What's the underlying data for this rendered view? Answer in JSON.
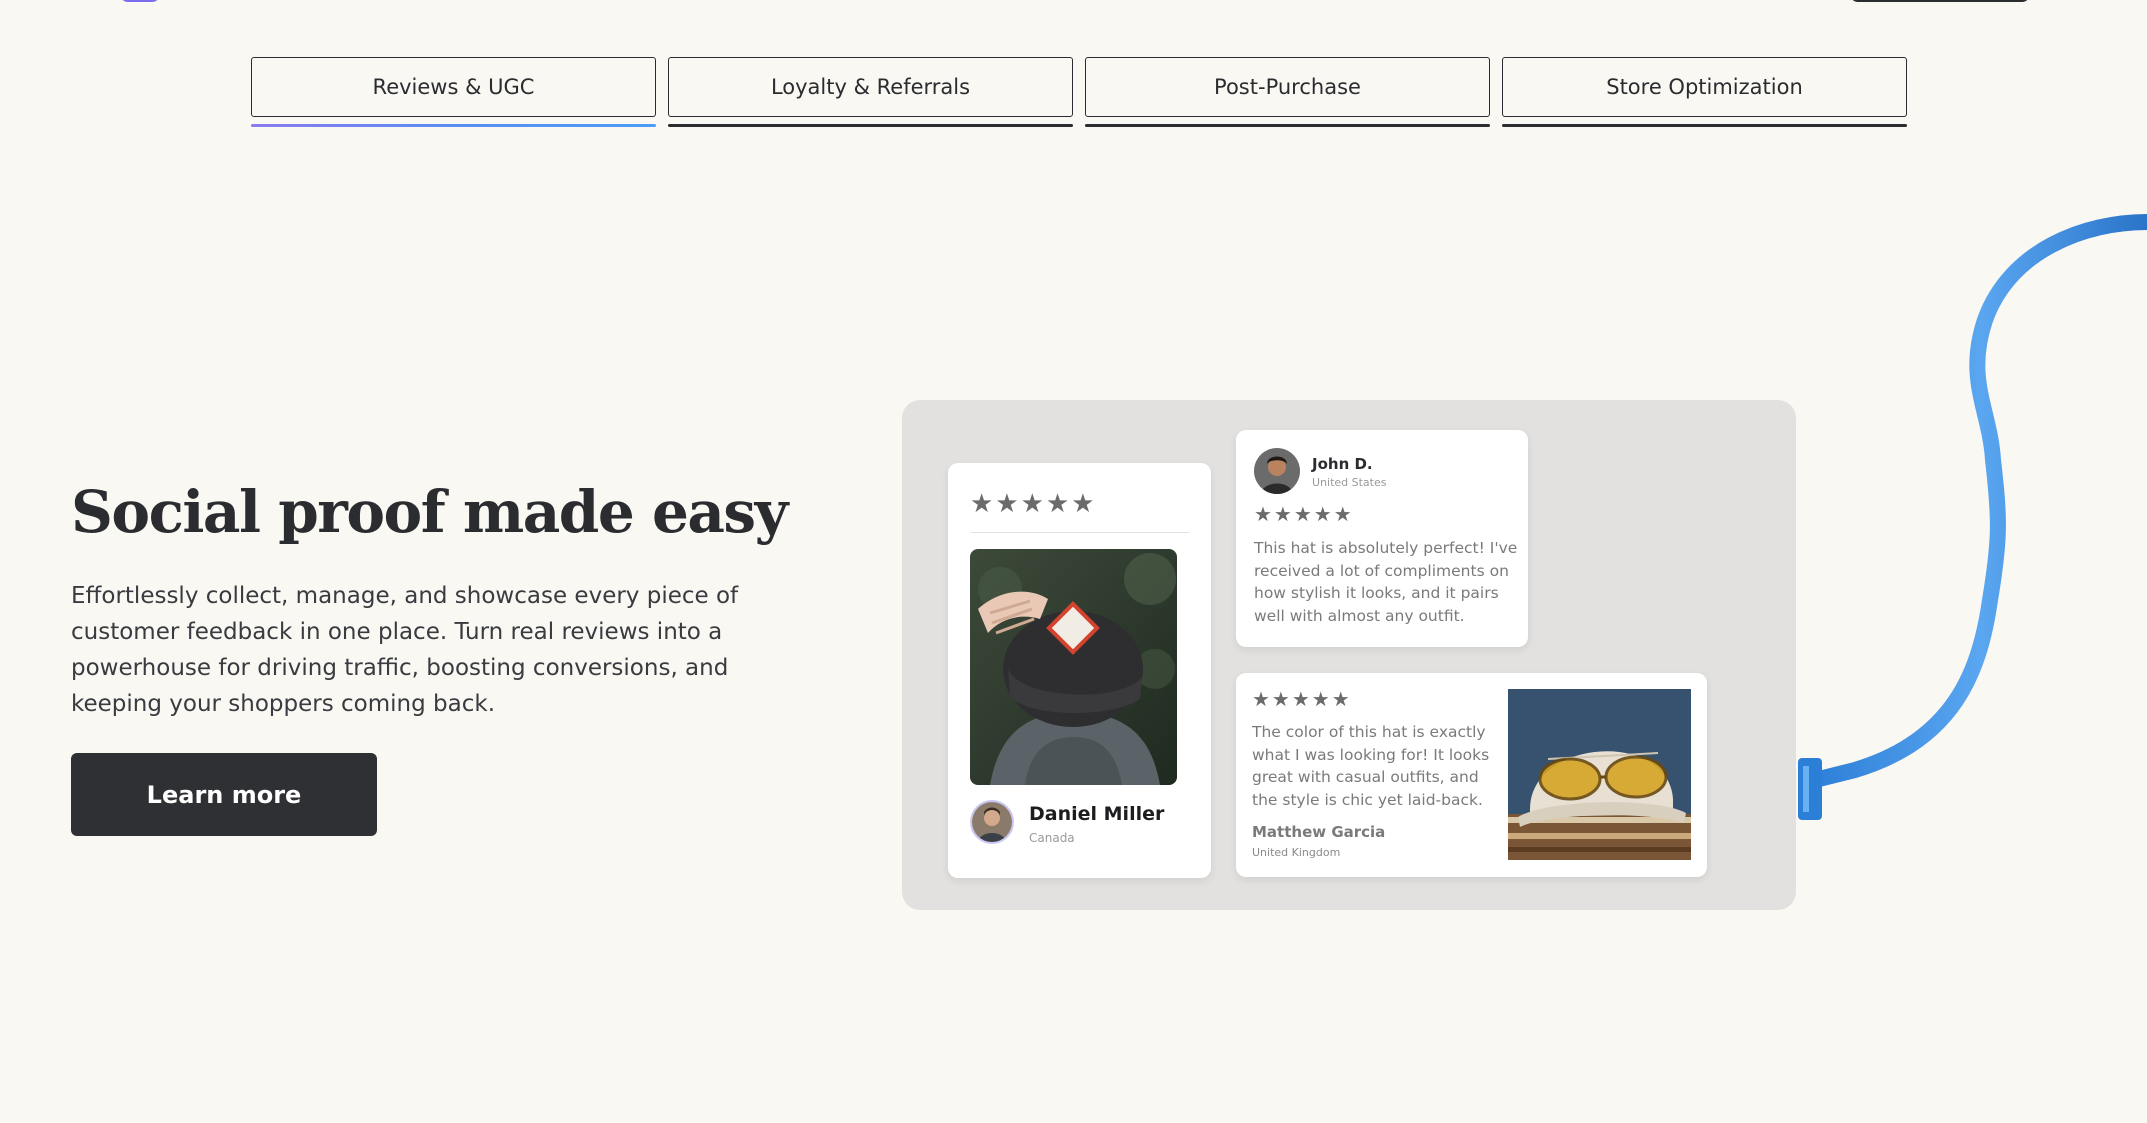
{
  "tabs": [
    {
      "label": "Reviews & UGC",
      "active": true
    },
    {
      "label": "Loyalty & Referrals",
      "active": false
    },
    {
      "label": "Post-Purchase",
      "active": false
    },
    {
      "label": "Store Optimization",
      "active": false
    }
  ],
  "hero": {
    "title": "Social proof made easy",
    "description": "Effortlessly collect, manage, and showcase every piece of customer feedback in one place. Turn real reviews into a powerhouse for driving traffic, boosting conversions, and keeping your shoppers coming back.",
    "cta_label": "Learn more"
  },
  "reviews": {
    "card1": {
      "stars": "★★★★★",
      "rating": 5,
      "name": "Daniel Miller",
      "location": "Canada"
    },
    "card2": {
      "stars": "★★★★★",
      "rating": 5,
      "name": "John D.",
      "location": "United States",
      "text": "This hat is absolutely perfect!  I've received a lot of compliments on how stylish it looks, and it pairs well with almost any outfit."
    },
    "card3": {
      "stars": "★★★★★",
      "rating": 5,
      "name": "Matthew Garcia",
      "location": "United Kingdom",
      "text": "The color of this hat is exactly what I was looking for! It looks great with casual outfits, and the style is chic yet laid-back."
    }
  },
  "colors": {
    "background": "#faf8f3",
    "button": "#2f3033",
    "active_tab_underline": "#5a8ef2",
    "panel": "#e2e1df",
    "cable": "#3a8ee6"
  },
  "icons": [
    "star-icon",
    "avatar-photo",
    "cap-photo",
    "hat-sunglasses-photo",
    "usb-cable-decoration"
  ]
}
